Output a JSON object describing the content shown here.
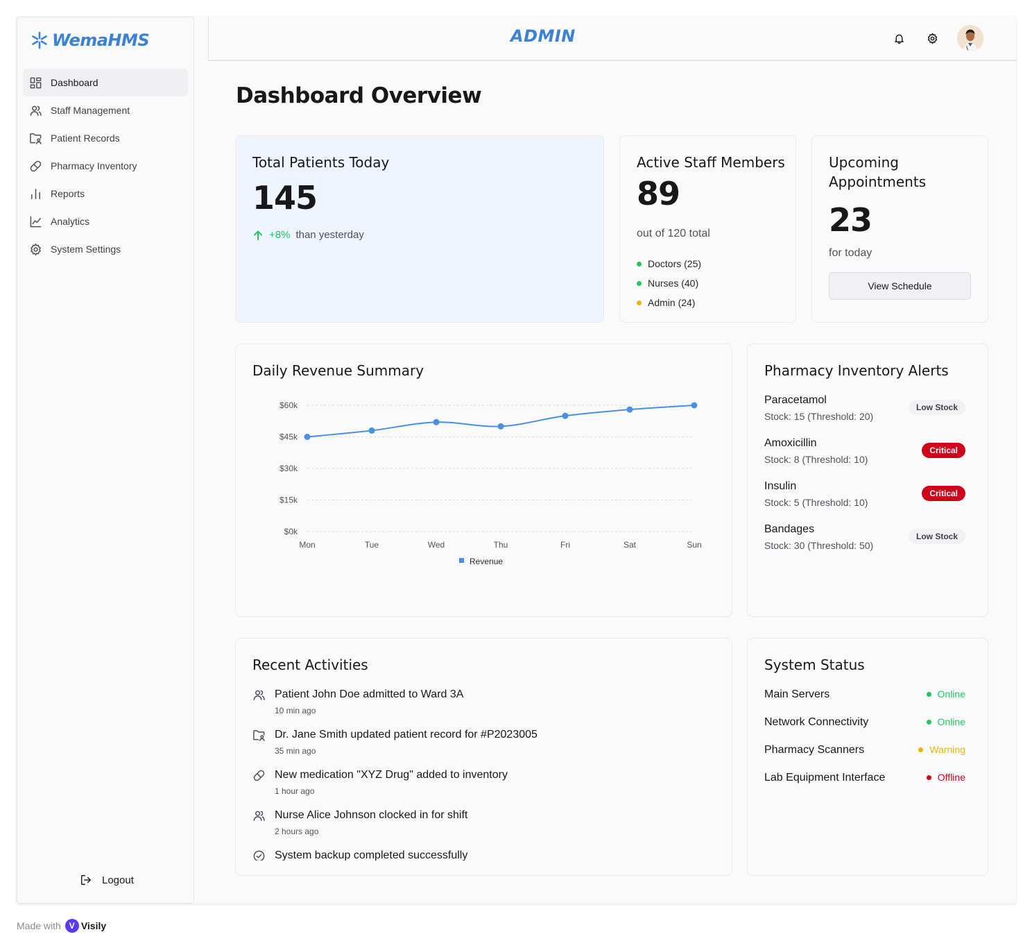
{
  "brand": {
    "name": "WemaHMS",
    "accent": "#3b82d6"
  },
  "header": {
    "role_title": "ADMIN",
    "icons": [
      "bell-icon",
      "gear-icon"
    ],
    "avatar": "user-avatar"
  },
  "sidebar": {
    "items": [
      {
        "label": "Dashboard",
        "icon": "grid-icon",
        "active": true
      },
      {
        "label": "Staff Management",
        "icon": "users-icon"
      },
      {
        "label": "Patient Records",
        "icon": "folder-user-icon"
      },
      {
        "label": "Pharmacy Inventory",
        "icon": "pill-icon"
      },
      {
        "label": "Reports",
        "icon": "bar-chart-icon"
      },
      {
        "label": "Analytics",
        "icon": "line-chart-icon"
      },
      {
        "label": "System Settings",
        "icon": "gear-icon"
      }
    ],
    "logout_label": "Logout"
  },
  "page": {
    "title": "Dashboard Overview"
  },
  "stats": {
    "patients": {
      "title": "Total Patients Today",
      "value": "145",
      "change": "+8%",
      "change_text": "than yesterday"
    },
    "staff": {
      "title": "Active Staff Members",
      "value": "89",
      "subtitle": "out of 120 total",
      "breakdown": [
        {
          "label": "Doctors (25)",
          "color": "#22c55e"
        },
        {
          "label": "Nurses (40)",
          "color": "#22c55e"
        },
        {
          "label": "Admin (24)",
          "color": "#eab308"
        }
      ]
    },
    "appointments": {
      "title_line1": "Upcoming",
      "title_line2": "Appointments",
      "value": "23",
      "subtitle": "for today",
      "button_label": "View Schedule"
    }
  },
  "revenue": {
    "title": "Daily Revenue Summary",
    "chart_data": {
      "type": "line",
      "categories": [
        "Mon",
        "Tue",
        "Wed",
        "Thu",
        "Fri",
        "Sat",
        "Sun"
      ],
      "series": [
        {
          "name": "Revenue",
          "values": [
            45000,
            48000,
            52000,
            50000,
            55000,
            58000,
            60000
          ],
          "color": "#4a90e2"
        }
      ],
      "y_ticks": [
        "$0k",
        "$15k",
        "$30k",
        "$45k",
        "$60k"
      ],
      "ylim": [
        0,
        60000
      ],
      "grid": true,
      "legend": "bottom-center"
    }
  },
  "inventory": {
    "title": "Pharmacy Inventory Alerts",
    "items": [
      {
        "name": "Paracetamol",
        "stock": "Stock: 15 (Threshold: 20)",
        "status": "Low Stock",
        "level": "low"
      },
      {
        "name": "Amoxicillin",
        "stock": "Stock: 8 (Threshold: 10)",
        "status": "Critical",
        "level": "crit"
      },
      {
        "name": "Insulin",
        "stock": "Stock: 5 (Threshold: 10)",
        "status": "Critical",
        "level": "crit"
      },
      {
        "name": "Bandages",
        "stock": "Stock: 30 (Threshold: 50)",
        "status": "Low Stock",
        "level": "low"
      }
    ]
  },
  "activities": {
    "title": "Recent Activities",
    "items": [
      {
        "text": "Patient John Doe admitted to Ward 3A",
        "time": "10 min ago",
        "icon": "users-icon"
      },
      {
        "text": "Dr. Jane Smith updated patient record for #P2023005",
        "time": "35 min ago",
        "icon": "folder-user-icon"
      },
      {
        "text": "New medication \"XYZ Drug\" added to inventory",
        "time": "1 hour ago",
        "icon": "pill-icon"
      },
      {
        "text": "Nurse Alice Johnson clocked in for shift",
        "time": "2 hours ago",
        "icon": "users-icon"
      },
      {
        "text": "System backup completed successfully",
        "time": "",
        "icon": "check-circle-icon"
      }
    ]
  },
  "system": {
    "title": "System Status",
    "items": [
      {
        "name": "Main Servers",
        "status": "Online",
        "color": "#22c55e"
      },
      {
        "name": "Network Connectivity",
        "status": "Online",
        "color": "#22c55e"
      },
      {
        "name": "Pharmacy Scanners",
        "status": "Warning",
        "color": "#eab308"
      },
      {
        "name": "Lab Equipment Interface",
        "status": "Offline",
        "color": "#d0021b"
      }
    ]
  },
  "footer": {
    "made_with": "Made with",
    "brand": "Visily"
  }
}
